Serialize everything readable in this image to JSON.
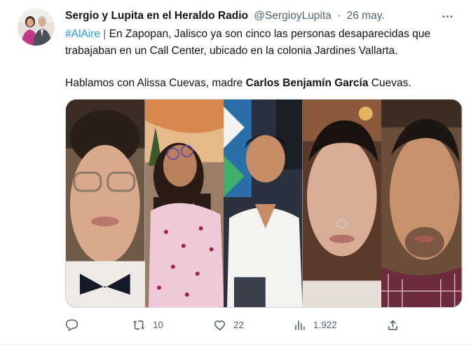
{
  "tweet": {
    "author": {
      "display_name": "Sergio y Lupita en el Heraldo Radio",
      "handle": "@SergioyLupita",
      "separator": "·",
      "date": "26 may."
    },
    "more_icon": "more-horizontal-icon",
    "text": {
      "hashtag": "#AlAire",
      "pipe": " | ",
      "line1": "En Zapopan, Jalisco ya son cinco las personas desaparecidas que trabajaban en un Call Center, ubicado en la colonia Jardines Vallarta.",
      "p2_before": "Hablamos con Alissa Cuevas, madre ",
      "p2_bold": "Carlos Benjamín García",
      "p2_after": " Cuevas."
    },
    "actions": {
      "reply_icon": "reply-icon",
      "retweet_icon": "retweet-icon",
      "retweet_count": "10",
      "like_icon": "heart-icon",
      "like_count": "22",
      "views_icon": "views-chart-icon",
      "views_count": "1.922",
      "share_icon": "share-icon"
    },
    "colors": {
      "link": "#1d9bf0",
      "secondary_text": "#536471",
      "primary_text": "#0f1419"
    }
  }
}
